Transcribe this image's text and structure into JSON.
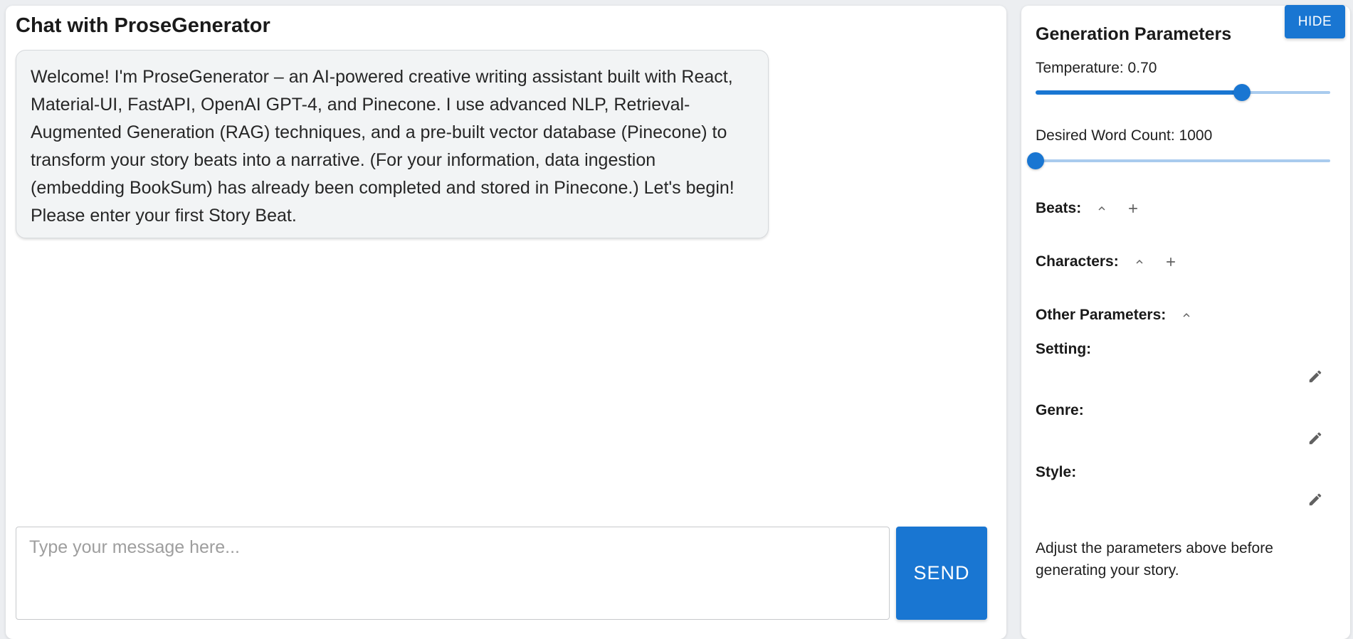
{
  "chat": {
    "title": "Chat with ProseGenerator",
    "messages": [
      {
        "role": "assistant",
        "text": "Welcome! I'm ProseGenerator – an AI-powered creative writing assistant built with React, Material-UI, FastAPI, OpenAI GPT-4, and Pinecone. I use advanced NLP, Retrieval-Augmented Generation (RAG) techniques, and a pre-built vector database (Pinecone) to transform your story beats into a narrative. (For your information, data ingestion (embedding BookSum) has already been completed and stored in Pinecone.) Let's begin! Please enter your first Story Beat."
      }
    ],
    "input": {
      "placeholder": "Type your message here...",
      "value": ""
    },
    "send_label": "SEND"
  },
  "params": {
    "title": "Generation Parameters",
    "hide_label": "HIDE",
    "temperature": {
      "label": "Temperature: 0.70",
      "value": 0.7,
      "min": 0,
      "max": 1
    },
    "word_count": {
      "label": "Desired Word Count: 1000",
      "value": 1000,
      "min": 1000,
      "max": 5000
    },
    "beats_label": "Beats:",
    "characters_label": "Characters:",
    "other_label": "Other Parameters:",
    "setting_label": "Setting:",
    "genre_label": "Genre:",
    "style_label": "Style:",
    "hint": "Adjust the parameters above before generating your story."
  },
  "colors": {
    "primary": "#1976d2",
    "slider_rail": "#a9cbee",
    "bubble_bg": "#f2f4f5"
  },
  "icons": {
    "collapse": "chevron-up-icon",
    "add": "plus-icon",
    "edit": "pencil-icon"
  }
}
